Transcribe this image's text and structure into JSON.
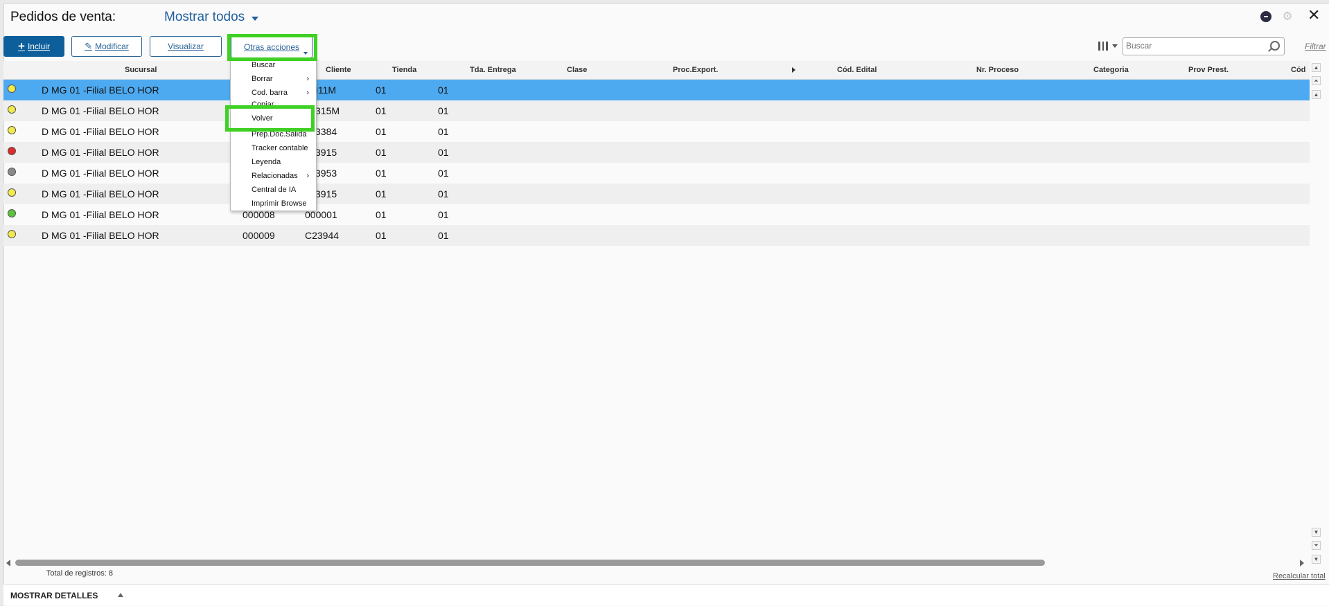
{
  "header": {
    "title": "Pedidos de venta:",
    "filter_label": "Mostrar todos"
  },
  "toolbar": {
    "incluir": "Incluir",
    "modificar": "Modificar",
    "visualizar": "Visualizar",
    "otras_acciones": "Otras acciones",
    "search_placeholder": "Buscar",
    "filtrar": "Filtrar"
  },
  "columns": [
    "Sucursal",
    "Cliente",
    "Tienda",
    "Tda. Entrega",
    "Clase",
    "Proc.Export.",
    "Cód. Edital",
    "Nr. Proceso",
    "Categoria",
    "Prov Prest.",
    "Cód"
  ],
  "rows": [
    {
      "status": "yellow",
      "sucursal": "D MG 01 -Filial BELO HOR",
      "pedido": "",
      "cliente": "I11M",
      "tienda": "01",
      "entrega": "01",
      "selected": true
    },
    {
      "status": "yellow",
      "sucursal": "D MG 01 -Filial BELO HOR",
      "pedido": "",
      "cliente": "315M",
      "tienda": "01",
      "entrega": "01"
    },
    {
      "status": "yellow",
      "sucursal": "D MG 01 -Filial BELO HOR",
      "pedido": "",
      "cliente": "3384",
      "tienda": "01",
      "entrega": "01"
    },
    {
      "status": "red",
      "sucursal": "D MG 01 -Filial BELO HOR",
      "pedido": "",
      "cliente": "3915",
      "tienda": "01",
      "entrega": "01"
    },
    {
      "status": "gray",
      "sucursal": "D MG 01 -Filial BELO HOR",
      "pedido": "",
      "cliente": "3953",
      "tienda": "01",
      "entrega": "01"
    },
    {
      "status": "yellow",
      "sucursal": "D MG 01 -Filial BELO HOR",
      "pedido": "",
      "cliente": "3915",
      "tienda": "01",
      "entrega": "01"
    },
    {
      "status": "green",
      "sucursal": "D MG 01 -Filial BELO HOR",
      "pedido": "000008",
      "cliente": "000001",
      "tienda": "01",
      "entrega": "01"
    },
    {
      "status": "yellow",
      "sucursal": "D MG 01 -Filial BELO HOR",
      "pedido": "000009",
      "cliente": "C23944",
      "tienda": "01",
      "entrega": "01"
    }
  ],
  "menu": {
    "items": [
      "Buscar",
      "Borrar",
      "Cod. barra",
      "Copiar",
      "Volver",
      "Prep.Doc.Salida",
      "Tracker contable",
      "Leyenda",
      "Relacionadas",
      "Central de IA",
      "Imprimir Browse"
    ]
  },
  "status_colors": {
    "yellow": "#f2ea4a",
    "red": "#e02a2a",
    "gray": "#8a8a8a",
    "green": "#5cc43a"
  },
  "colors": {
    "accent": "#0d5f9b",
    "selection": "#4eaaf0",
    "highlight": "#3ed022"
  },
  "footer": {
    "total": "Total de registros: 8",
    "recalcular": "Recalcular total",
    "details": "MOSTRAR DETALLES"
  }
}
